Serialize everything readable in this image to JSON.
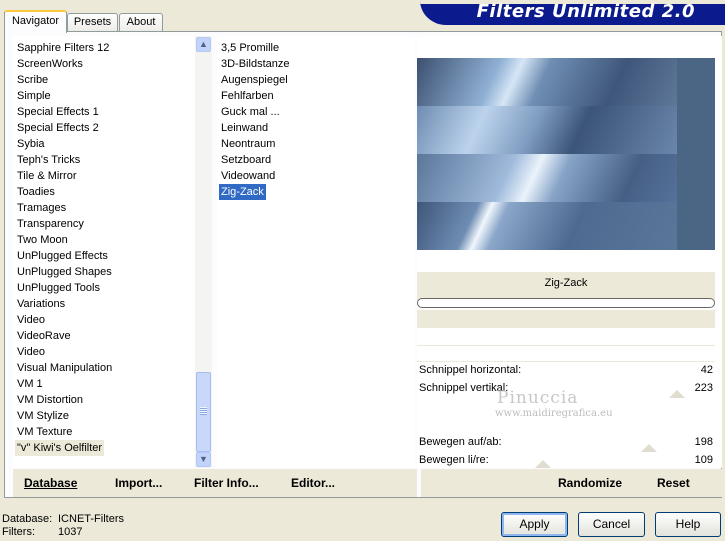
{
  "header": {
    "title": "Filters Unlimited 2.0"
  },
  "tabs": [
    {
      "label": "Navigator",
      "active": true
    },
    {
      "label": "Presets",
      "active": false
    },
    {
      "label": "About",
      "active": false
    }
  ],
  "categories": [
    "Sapphire Filters 12",
    "ScreenWorks",
    "Scribe",
    "Simple",
    "Special Effects 1",
    "Special Effects 2",
    "Sybia",
    "Teph's Tricks",
    "Tile & Mirror",
    "Toadies",
    "Tramages",
    "Transparency",
    "Two Moon",
    "UnPlugged Effects",
    "UnPlugged Shapes",
    "UnPlugged Tools",
    "Variations",
    "Video",
    "VideoRave",
    "Video",
    "Visual Manipulation",
    "VM 1",
    "VM Distortion",
    "VM Stylize",
    "VM Texture",
    "\"v\" Kiwi's Oelfilter"
  ],
  "selected_category": "\"v\" Kiwi's Oelfilter",
  "filters": [
    "3,5 Promille",
    "3D-Bildstanze",
    "Augenspiegel",
    "Fehlfarben",
    "Guck mal ...",
    "Leinwand",
    "Neontraum",
    "Setzboard",
    "Videowand",
    "Zig-Zack"
  ],
  "selected_filter": "Zig-Zack",
  "preview": {
    "filter_name": "Zig-Zack"
  },
  "params": [
    {
      "label": "Schnippel horizontal:",
      "value": "42"
    },
    {
      "label": "Schnippel vertikal:",
      "value": "223"
    },
    {
      "label": "Bewegen auf/ab:",
      "value": "198"
    },
    {
      "label": "Bewegen li/re:",
      "value": "109"
    }
  ],
  "watermark": {
    "line1": "Pinuccia",
    "line2": "www.maidiregrafica.eu"
  },
  "toolbar": {
    "database": "Database",
    "import": "Import...",
    "filter_info": "Filter Info...",
    "editor": "Editor...",
    "randomize": "Randomize",
    "reset": "Reset"
  },
  "footer": {
    "database_label": "Database:",
    "database_value": "ICNET-Filters",
    "filters_label": "Filters:",
    "filters_value": "1037"
  },
  "buttons": {
    "apply": "Apply",
    "cancel": "Cancel",
    "help": "Help"
  },
  "colors": {
    "selection": "#316ac5",
    "banner": "#0b1a8c",
    "panel_bg": "#ece9d8"
  }
}
